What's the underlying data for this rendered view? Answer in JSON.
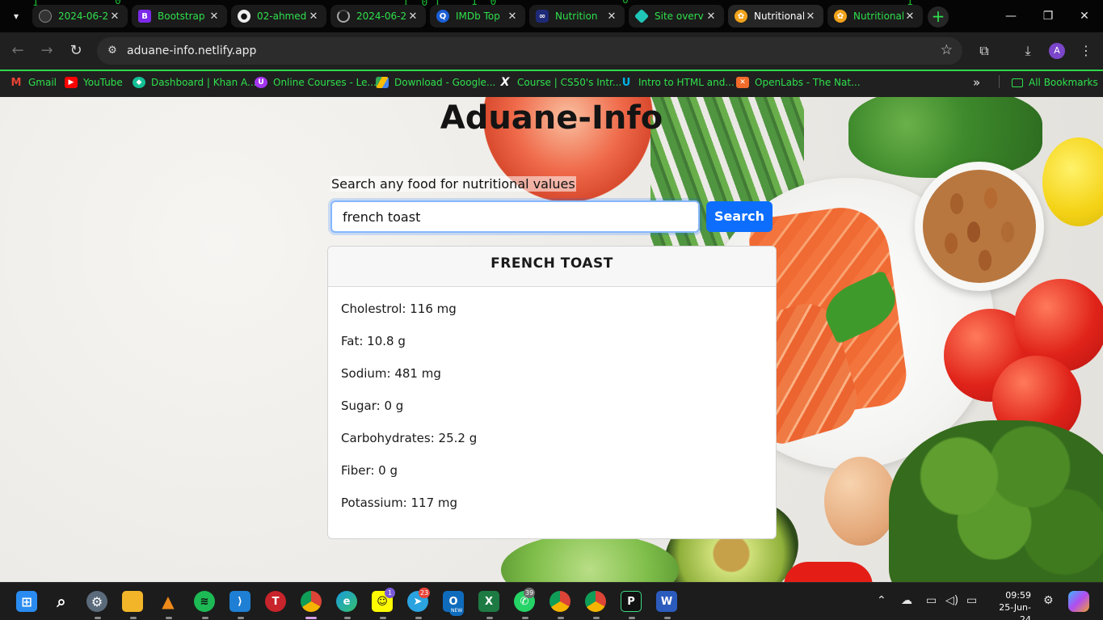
{
  "browser": {
    "tabs": [
      {
        "title": "2024-06-2",
        "icon": "github-circle-icon",
        "color": "#333333"
      },
      {
        "title": "Bootstrap",
        "icon": "bootstrap-icon",
        "color": "#7c2ae8"
      },
      {
        "title": "02-ahmed",
        "icon": "github-icon",
        "color": "#333333"
      },
      {
        "title": "2024-06-2",
        "icon": "loading-icon",
        "color": "#444444"
      },
      {
        "title": "IMDb Top",
        "icon": "q-logo-icon",
        "color": "#1a5fd6"
      },
      {
        "title": "Nutrition",
        "icon": "api-ninjas-icon",
        "color": "#1e2a78"
      },
      {
        "title": "Site overv",
        "icon": "netlify-icon",
        "color": "#20c6b7"
      },
      {
        "title": "Nutritional",
        "icon": "food-logo-icon",
        "color": "#f2a31b"
      },
      {
        "title": "Nutritional",
        "icon": "food-logo-icon",
        "color": "#f2a31b"
      }
    ],
    "active_tab": 7,
    "new_tab_label": "+",
    "window_controls": {
      "minimize": "—",
      "maximize": "❐",
      "close": "✕"
    },
    "url": "aduane-info.netlify.app",
    "profile_initial": "A",
    "bookmarks": [
      {
        "label": "Gmail",
        "icon": "gmail-icon",
        "color": "#ea4335"
      },
      {
        "label": "YouTube",
        "icon": "youtube-icon",
        "color": "#ff0000"
      },
      {
        "label": "Dashboard | Khan A...",
        "icon": "khan-academy-icon",
        "color": "#14bf96"
      },
      {
        "label": "Online Courses - Le...",
        "icon": "udemy-icon",
        "color": "#a435f0"
      },
      {
        "label": "Download - Google...",
        "icon": "google-drive-icon",
        "color": "#f4b400"
      },
      {
        "label": "Course | CS50's Intr...",
        "icon": "edx-icon",
        "color": "#ffffff"
      },
      {
        "label": "Intro to HTML and...",
        "icon": "udacity-icon",
        "color": "#02b3e4"
      },
      {
        "label": "OpenLabs - The Nat...",
        "icon": "openlabs-icon",
        "color": "#f26b2a"
      }
    ],
    "bookmarks_overflow": "»",
    "all_bookmarks": "All Bookmarks"
  },
  "app": {
    "title": "Aduane-Info",
    "search_label": "Search any food for nutritional values",
    "search_value": "french toast",
    "search_button": "Search",
    "result": {
      "food": "FRENCH TOAST",
      "nutrients": [
        {
          "label": "Cholestrol: 116 mg"
        },
        {
          "label": "Fat: 10.8 g"
        },
        {
          "label": "Sodium: 481 mg"
        },
        {
          "label": "Sugar: 0 g"
        },
        {
          "label": "Carbohydrates: 25.2 g"
        },
        {
          "label": "Fiber: 0 g"
        },
        {
          "label": "Potassium: 117 mg"
        }
      ]
    }
  },
  "taskbar": {
    "apps": [
      {
        "name": "start-icon",
        "glyph": "⊞",
        "color": "#2a8cf0"
      },
      {
        "name": "search-icon",
        "glyph": "⌕",
        "color": "transparent"
      },
      {
        "name": "settings-icon",
        "glyph": "⚙",
        "color": "#5b6b7c"
      },
      {
        "name": "file-explorer-icon",
        "glyph": "▬",
        "color": "#f2b52a"
      },
      {
        "name": "vlc-icon",
        "glyph": "▲",
        "color": "#f08a1a"
      },
      {
        "name": "spotify-icon",
        "glyph": "≋",
        "color": "#1db954"
      },
      {
        "name": "vscode-icon",
        "glyph": "⟨⟩",
        "color": "#1e7fd4"
      },
      {
        "name": "t-app-icon",
        "glyph": "T",
        "color": "#c8242b"
      },
      {
        "name": "chrome-icon",
        "glyph": "◉",
        "color": "#3a7a3a"
      },
      {
        "name": "edge-icon",
        "glyph": "e",
        "color": "#1a9be0"
      },
      {
        "name": "snapchat-icon",
        "glyph": "☺",
        "color": "#fffc00"
      },
      {
        "name": "telegram-icon",
        "glyph": "➤",
        "color": "#2aa3e0"
      },
      {
        "name": "outlook-icon",
        "glyph": "O",
        "color": "#0f6cbd"
      },
      {
        "name": "excel-icon",
        "glyph": "X",
        "color": "#1d7a43"
      },
      {
        "name": "whatsapp-icon",
        "glyph": "✆",
        "color": "#25d366"
      },
      {
        "name": "chrome-profile-icon",
        "glyph": "◉",
        "color": "#3a7a3a"
      },
      {
        "name": "chrome-profile2-icon",
        "glyph": "◉",
        "color": "#3a7a3a"
      },
      {
        "name": "pycharm-icon",
        "glyph": "P",
        "color": "#111111"
      },
      {
        "name": "word-icon",
        "glyph": "W",
        "color": "#2b5bbd"
      }
    ],
    "badges": {
      "snapchat": "1",
      "telegram": "23",
      "outlook": "NEW",
      "whatsapp": "39"
    },
    "time": "09:59",
    "date": "25-Jun-24"
  }
}
